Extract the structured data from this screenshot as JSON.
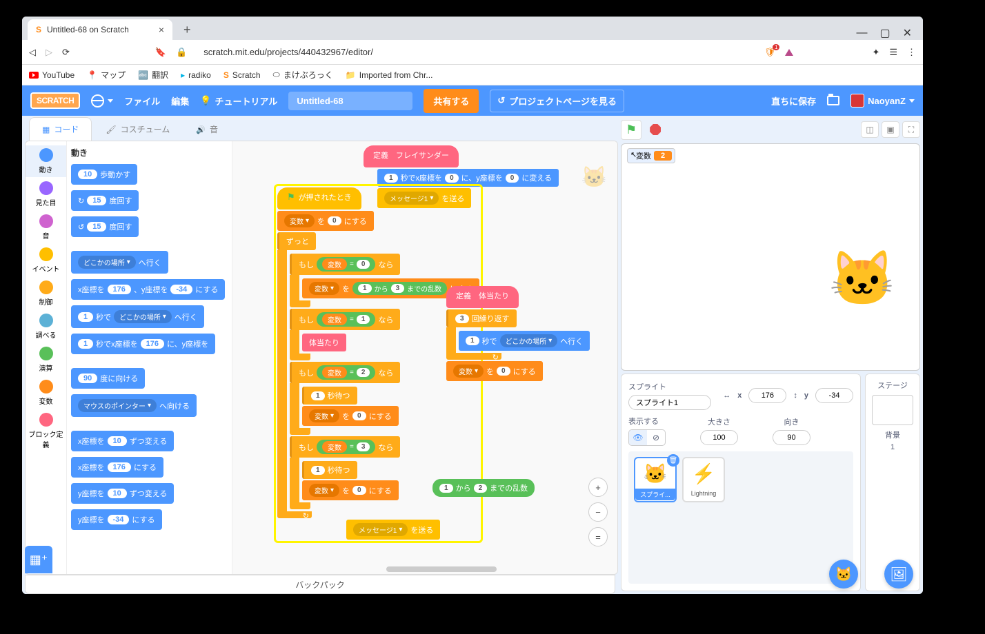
{
  "browser": {
    "tab_title": "Untitled-68 on Scratch",
    "url": "scratch.mit.edu/projects/440432967/editor/",
    "bookmarks": [
      "YouTube",
      "マップ",
      "翻訳",
      "radiko",
      "Scratch",
      "まけぶろっく",
      "Imported from Chr..."
    ]
  },
  "menu": {
    "file": "ファイル",
    "edit": "編集",
    "tutorials": "チュートリアル",
    "project_name": "Untitled-68",
    "share": "共有する",
    "see_page": "プロジェクトページを見る",
    "saved": "直ちに保存",
    "username": "NaoyanZ"
  },
  "tabs": {
    "code": "コード",
    "costumes": "コスチューム",
    "sounds": "音"
  },
  "categories": [
    {
      "label": "動き",
      "color": "#4c97ff"
    },
    {
      "label": "見た目",
      "color": "#9966ff"
    },
    {
      "label": "音",
      "color": "#cf63cf"
    },
    {
      "label": "イベント",
      "color": "#ffbf00"
    },
    {
      "label": "制御",
      "color": "#ffab19"
    },
    {
      "label": "調べる",
      "color": "#5cb1d6"
    },
    {
      "label": "演算",
      "color": "#59c059"
    },
    {
      "label": "変数",
      "color": "#ff8c1a"
    },
    {
      "label": "ブロック定義",
      "color": "#ff6680"
    }
  ],
  "palette": {
    "title": "動き",
    "move_steps": {
      "n": "10",
      "text": "歩動かす"
    },
    "turn_cw": {
      "n": "15",
      "text": "度回す"
    },
    "turn_ccw": {
      "n": "15",
      "text": "度回す"
    },
    "goto": {
      "dd": "どこかの場所",
      "text": "へ行く"
    },
    "goto_xy": {
      "pre": "x座標を",
      "x": "176",
      "mid": "、y座標を",
      "y": "-34",
      "post": "にする"
    },
    "glide_to": {
      "sec": "1",
      "t1": "秒で",
      "dd": "どこかの場所",
      "t2": "へ行く"
    },
    "glide_xy": {
      "sec": "1",
      "t1": "秒でx座標を",
      "x": "176",
      "t2": "に、y座標を"
    },
    "point_dir": {
      "deg": "90",
      "text": "度に向ける"
    },
    "point_to": {
      "dd": "マウスのポインター",
      "text": "へ向ける"
    },
    "change_x": {
      "pre": "x座標を",
      "n": "10",
      "post": "ずつ変える"
    },
    "set_x": {
      "pre": "x座標を",
      "n": "176",
      "post": "にする"
    },
    "change_y": {
      "pre": "y座標を",
      "n": "10",
      "post": "ずつ変える"
    },
    "set_y": {
      "pre": "y座標を",
      "n": "-34",
      "post": "にする"
    }
  },
  "scripts": {
    "def1": "定義　フレイサンダー",
    "glide1": {
      "sec": "1",
      "t1": "秒でx座標を",
      "x": "0",
      "t2": "に、y座標を",
      "y": "0",
      "t3": "に変える"
    },
    "msg_dd": "メッセージ1",
    "msg_send": "を送る",
    "when_clicked": "が押されたとき",
    "setvar": {
      "var": "変数",
      "mid": "を",
      "val": "0",
      "post": "にする"
    },
    "forever": "ずっと",
    "if_lbl": "もし",
    "then_lbl": "なら",
    "var_name": "変数",
    "cmp0": "0",
    "cmp1": "1",
    "cmp2": "2",
    "cmp3": "3",
    "rand_from": "1",
    "rand_to": "3",
    "rand_from_t": "から",
    "rand_to_t": "までの乱数",
    "set_to": "にする",
    "body_hit": "体当たり",
    "wait_sec": "1",
    "wait_t": "秒待つ",
    "def2": "定義　体当たり",
    "repeat_n": "3",
    "repeat_t": "回繰り返す",
    "glide_rand": {
      "sec": "1",
      "t1": "秒で",
      "dd": "どこかの場所",
      "t2": "へ行く"
    },
    "loose_rand": {
      "a": "1",
      "mid": "から",
      "b": "2",
      "post": "までの乱数"
    }
  },
  "stage": {
    "var_label": "変数",
    "var_val": "2"
  },
  "sprite": {
    "label": "スプライト",
    "name": "スプライト1",
    "x_lbl": "x",
    "x": "176",
    "y_lbl": "y",
    "y": "-34",
    "show_lbl": "表示する",
    "size_lbl": "大きさ",
    "size": "100",
    "dir_lbl": "向き",
    "dir": "90",
    "sprites": [
      {
        "name": "スプライ...",
        "emoji": "🐱"
      },
      {
        "name": "Lightning",
        "emoji": "⚡"
      }
    ],
    "stage_lbl": "ステージ",
    "backdrop_lbl": "背景",
    "backdrop_n": "1"
  },
  "backpack": "バックパック"
}
